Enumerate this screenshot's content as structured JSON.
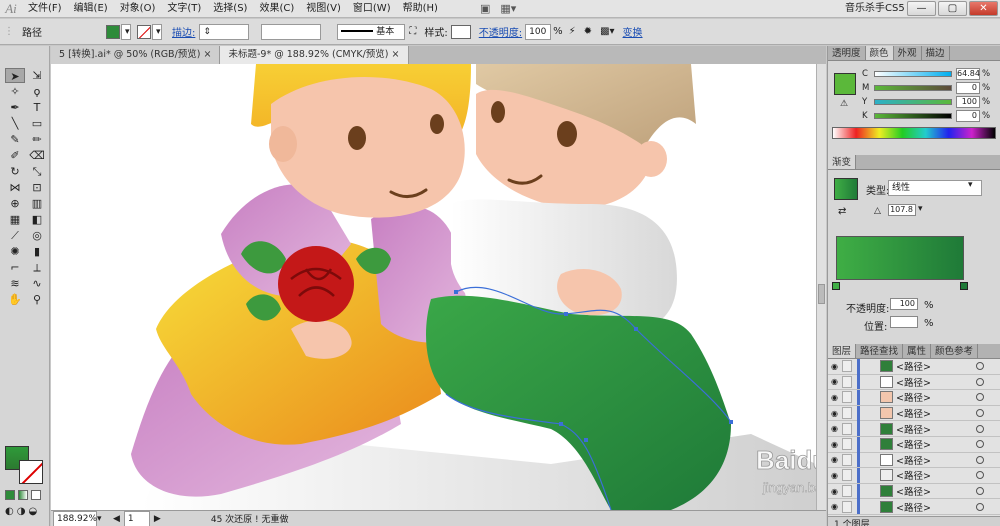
{
  "menubar": {
    "logo": "Ai",
    "items": [
      "文件(F)",
      "编辑(E)",
      "对象(O)",
      "文字(T)",
      "选择(S)",
      "效果(C)",
      "视图(V)",
      "窗口(W)",
      "帮助(H)"
    ],
    "workspace": "音乐杀手CS5",
    "window_buttons": [
      "—",
      "▢",
      "✕"
    ]
  },
  "control": {
    "selection_label": "路径",
    "fill_color": "#2e8b3a",
    "stroke_label": "描边:",
    "brush_label": "基本",
    "style_label": "样式:",
    "opacity_label": "不透明度:",
    "opacity_value": "100",
    "opacity_unit": "%",
    "transform_label": "变换"
  },
  "tabs": [
    {
      "label": "5 [转换].ai* @ 50% (RGB/预览)",
      "close": "×"
    },
    {
      "label": "未标题-9* @ 188.92% (CMYK/预览)",
      "close": "×"
    }
  ],
  "status": {
    "zoom": "188.92%",
    "page": "1",
    "message": "45 次还原 ! 无重做"
  },
  "color_panel": {
    "tabs": [
      "透明度",
      "颜色",
      "外观",
      "描边"
    ],
    "swatch": "#5bb83a",
    "channels": [
      {
        "name": "C",
        "value": "64.84"
      },
      {
        "name": "M",
        "value": "0"
      },
      {
        "name": "Y",
        "value": "100"
      },
      {
        "name": "K",
        "value": "0"
      }
    ]
  },
  "gradient_panel": {
    "tab": "渐变",
    "type_label": "类型:",
    "type_value": "线性",
    "angle": "107.8",
    "gradient_start": "#3fae45",
    "gradient_end": "#1f7a38",
    "opacity_label": "不透明度:",
    "opacity_value": "100",
    "location_label": "位置:",
    "location_value": "",
    "percent": "%"
  },
  "layers_panel": {
    "tabs": [
      "图层",
      "路径查找",
      "属性",
      "颜色参考"
    ],
    "items": [
      {
        "name": "<路径>",
        "thumb": "#2f7f3a"
      },
      {
        "name": "<路径>",
        "thumb": "#ffffff"
      },
      {
        "name": "<路径>",
        "thumb": "#f2c6ad"
      },
      {
        "name": "<路径>",
        "thumb": "#f2c6ad"
      },
      {
        "name": "<路径>",
        "thumb": "#2f7f3a"
      },
      {
        "name": "<路径>",
        "thumb": "#2f7f3a"
      },
      {
        "name": "<路径>",
        "thumb": "#ffffff"
      },
      {
        "name": "<路径>",
        "thumb": "#eeeeee"
      },
      {
        "name": "<路径>",
        "thumb": "#2f7f3a"
      },
      {
        "name": "<路径>",
        "thumb": "#2f7f3a"
      }
    ],
    "footer": "1 个图层"
  },
  "watermark": {
    "line1": "Baidu 经验",
    "line2": "jingyan.baidu.com"
  }
}
